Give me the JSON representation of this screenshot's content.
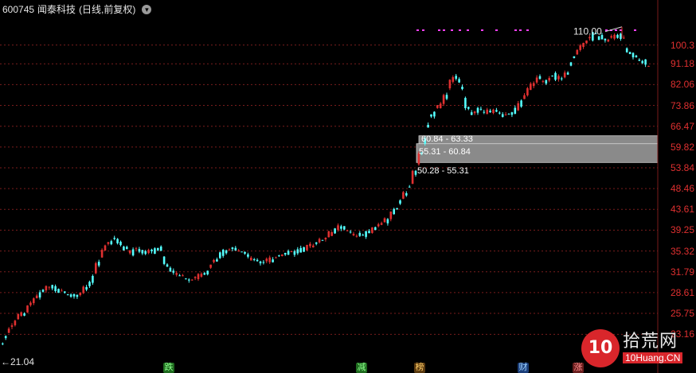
{
  "header": {
    "code": "600745",
    "name": "闻泰科技",
    "mode": "(日线,前复权)",
    "dropdown_icon": "chevron-down-icon"
  },
  "colors": {
    "background": "#000000",
    "up": "#e03030",
    "down": "#54ffff",
    "grid": "#7a1d1d",
    "axis_text": "#e03030",
    "range_fill": "#8a8a8a",
    "event_marks": "#ff3fff"
  },
  "chart_data": {
    "type": "candlestick",
    "y_scale": "log",
    "ylim": [
      19.5,
      123
    ],
    "y_tick_labels": [
      "100.3",
      "91.18",
      "82.06",
      "73.86",
      "66.47",
      "59.82",
      "53.84",
      "48.46",
      "43.61",
      "39.25",
      "35.32",
      "31.79",
      "28.61",
      "25.75",
      "23.16"
    ],
    "highest_label": "110.00",
    "lowest_label": "21.04",
    "volume_ranges": [
      {
        "label": "50.28 - 55.31",
        "low": 50.28,
        "high": 55.31
      },
      {
        "label": "55.31 - 60.84",
        "low": 55.31,
        "high": 60.84
      },
      {
        "label": "60.84 - 63.33",
        "low": 60.84,
        "high": 63.33
      }
    ],
    "trend": [
      [
        0,
        21.8
      ],
      [
        8,
        23.2
      ],
      [
        16,
        24.3
      ],
      [
        24,
        25.2
      ],
      [
        32,
        26.0
      ],
      [
        40,
        27.1
      ],
      [
        50,
        28.5
      ],
      [
        62,
        29.6
      ],
      [
        75,
        29.0
      ],
      [
        90,
        28.3
      ],
      [
        100,
        28.2
      ],
      [
        112,
        29.9
      ],
      [
        124,
        33.5
      ],
      [
        134,
        36.2
      ],
      [
        144,
        38.1
      ],
      [
        152,
        36.5
      ],
      [
        162,
        35.2
      ],
      [
        172,
        35.8
      ],
      [
        182,
        35.1
      ],
      [
        192,
        35.5
      ],
      [
        200,
        36.0
      ],
      [
        210,
        32.8
      ],
      [
        220,
        31.6
      ],
      [
        230,
        31.0
      ],
      [
        240,
        30.4
      ],
      [
        250,
        31.2
      ],
      [
        260,
        32.0
      ],
      [
        270,
        33.6
      ],
      [
        280,
        35.0
      ],
      [
        290,
        35.8
      ],
      [
        300,
        35.4
      ],
      [
        310,
        34.6
      ],
      [
        320,
        33.8
      ],
      [
        330,
        33.4
      ],
      [
        340,
        33.9
      ],
      [
        350,
        34.5
      ],
      [
        360,
        35.1
      ],
      [
        370,
        35.3
      ],
      [
        380,
        35.6
      ],
      [
        390,
        36.1
      ],
      [
        400,
        37.0
      ],
      [
        410,
        37.9
      ],
      [
        420,
        39.5
      ],
      [
        430,
        40.2
      ],
      [
        440,
        39.0
      ],
      [
        450,
        38.3
      ],
      [
        460,
        38.7
      ],
      [
        470,
        39.6
      ],
      [
        480,
        40.6
      ],
      [
        490,
        42.1
      ],
      [
        500,
        44.5
      ],
      [
        510,
        47.8
      ],
      [
        518,
        51.0
      ],
      [
        526,
        55.5
      ],
      [
        532,
        61.5
      ],
      [
        538,
        69.0
      ],
      [
        544,
        71.5
      ],
      [
        552,
        74.0
      ],
      [
        560,
        77.0
      ],
      [
        568,
        83.5
      ],
      [
        574,
        86.0
      ],
      [
        580,
        80.0
      ],
      [
        586,
        74.0
      ],
      [
        594,
        70.5
      ],
      [
        602,
        72.0
      ],
      [
        610,
        71.5
      ],
      [
        618,
        72.5
      ],
      [
        626,
        71.0
      ],
      [
        634,
        70.2
      ],
      [
        642,
        71.0
      ],
      [
        650,
        73.5
      ],
      [
        658,
        76.5
      ],
      [
        666,
        81.0
      ],
      [
        672,
        83.0
      ],
      [
        678,
        85.0
      ],
      [
        686,
        84.0
      ],
      [
        694,
        86.5
      ],
      [
        702,
        84.5
      ],
      [
        710,
        85.0
      ],
      [
        716,
        92.0
      ],
      [
        722,
        96.0
      ],
      [
        728,
        98.0
      ],
      [
        734,
        101.5
      ],
      [
        740,
        104.0
      ],
      [
        748,
        106.0
      ],
      [
        756,
        104.5
      ],
      [
        764,
        103.0
      ],
      [
        772,
        105.0
      ],
      [
        780,
        106.0
      ],
      [
        786,
        100.5
      ],
      [
        792,
        97.0
      ],
      [
        798,
        94.5
      ],
      [
        804,
        93.0
      ],
      [
        810,
        91.5
      ],
      [
        814,
        90.0
      ]
    ]
  },
  "markers": [
    {
      "label": "跌",
      "bg": "#1f6b1f",
      "fg": "#8dff8d"
    },
    {
      "label": "减",
      "bg": "#1f6b1f",
      "fg": "#8dff8d"
    },
    {
      "label": "榜",
      "bg": "#5a3a10",
      "fg": "#ffcc66"
    },
    {
      "label": "财",
      "bg": "#1c3f7a",
      "fg": "#9ad0ff"
    },
    {
      "label": "涨",
      "bg": "#6b1f1f",
      "fg": "#ff8d8d"
    }
  ],
  "watermark": {
    "circle_text": "10",
    "cn": "拾荒网",
    "en": "10Huang.CN"
  }
}
